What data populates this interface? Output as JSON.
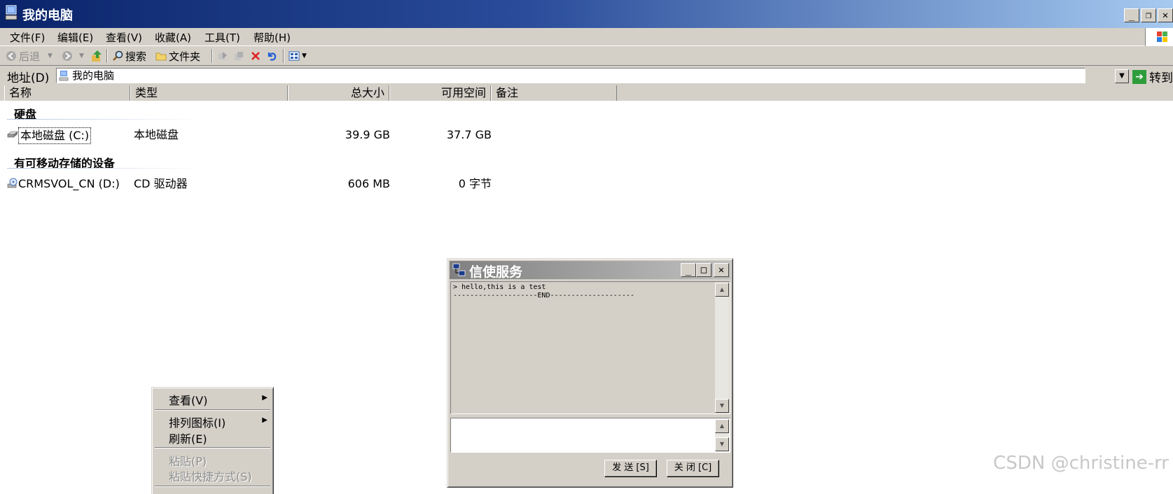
{
  "window": {
    "title": "我的电脑"
  },
  "menu": [
    "文件(F)",
    "编辑(E)",
    "查看(V)",
    "收藏(A)",
    "工具(T)",
    "帮助(H)"
  ],
  "toolbar": {
    "back": "后退",
    "search": "搜索",
    "folders": "文件夹"
  },
  "address": {
    "label": "地址(D)",
    "value": "我的电脑",
    "go": "转到"
  },
  "columns": [
    "名称",
    "类型",
    "总大小",
    "可用空间",
    "备注"
  ],
  "groups": [
    {
      "title": "硬盘",
      "items": [
        {
          "name": "本地磁盘 (C:)",
          "type": "本地磁盘",
          "total": "39.9 GB",
          "free": "37.7 GB"
        }
      ]
    },
    {
      "title": "有可移动存储的设备",
      "items": [
        {
          "name": "CRMSVOL_CN (D:)",
          "type": "CD 驱动器",
          "total": "606 MB",
          "free": "0 字节"
        }
      ]
    }
  ],
  "context_menu": {
    "items": [
      "查看(V)",
      "排列图标(I)",
      "刷新(E)",
      "粘贴(P)",
      "粘贴快捷方式(S)"
    ],
    "disabled": [
      "粘贴(P)",
      "粘贴快捷方式(S)"
    ]
  },
  "dialog": {
    "title": "信使服务",
    "message": "> hello,this is a test\n--------------------END--------------------",
    "send": "发 送 [S]",
    "close": "关 闭 [C]"
  },
  "watermark": "CSDN @christine-rr"
}
